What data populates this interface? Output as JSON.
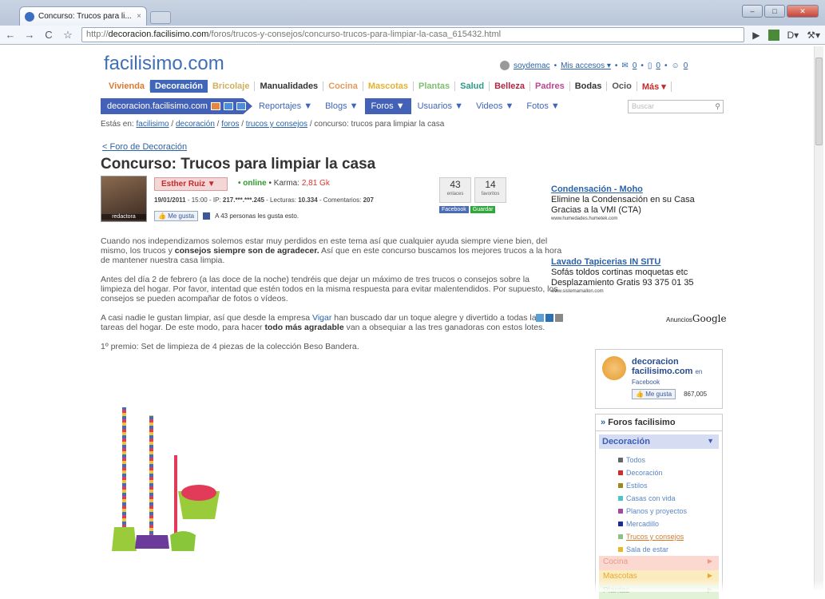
{
  "browser": {
    "tab_title": "Concurso: Trucos para li...",
    "tab_close": "×",
    "url_prefix": "http://",
    "url_domain": "decoracion.facilisimo.com",
    "url_path": "/foros/trucos-y-consejos/concurso-trucos-para-limpiar-la-casa_615432.html",
    "back": "←",
    "forward": "→",
    "reload": "C",
    "star": "☆",
    "page_menu": "D▾",
    "tools_menu": "⚒▾",
    "play": "▶"
  },
  "site": {
    "logo": "facilisimo.com",
    "user": {
      "username": "soydemac",
      "accesos": "Mis accesos ▾",
      "messages": "0",
      "notes": "0",
      "friends": "0"
    },
    "categories": [
      {
        "label": "Vivienda",
        "color": "#e0792c"
      },
      {
        "label": "Decoración",
        "color": "#ffffff"
      },
      {
        "label": "Bricolaje",
        "color": "#d0b060"
      },
      {
        "label": "Manualidades",
        "color": "#333333"
      },
      {
        "label": "Cocina",
        "color": "#e59a5a"
      },
      {
        "label": "Mascotas",
        "color": "#e6b12e"
      },
      {
        "label": "Plantas",
        "color": "#7cc06a"
      },
      {
        "label": "Salud",
        "color": "#2b9a8b"
      },
      {
        "label": "Belleza",
        "color": "#b02545"
      },
      {
        "label": "Padres",
        "color": "#c04590"
      },
      {
        "label": "Bodas",
        "color": "#333333"
      },
      {
        "label": "Ocio",
        "color": "#555555"
      },
      {
        "label": "Más ▾",
        "color": "#c42b2b"
      }
    ],
    "subnav_home": "decoracion.facilisimo.com",
    "subnav": [
      "Reportajes ▼",
      "Blogs ▼",
      "Foros ▼",
      "Usuarios ▼",
      "Videos ▼",
      "Fotos ▼"
    ],
    "search_placeholder": "Buscar",
    "search_icon": "⚲"
  },
  "breadcrumb": {
    "prefix": "Estás en:",
    "links": [
      "facilisimo",
      "decoración",
      "foros",
      "trucos y consejos"
    ],
    "current": "concurso: trucos para limpiar la casa"
  },
  "post": {
    "back_link": "< Foro de Decoración",
    "title": "Concurso: Trucos para limpiar la casa",
    "author": "Esther Ruiz ▼",
    "role": "redactora",
    "online": "• online",
    "karma_label": "• Karma:",
    "karma_value": "2,81 Gk",
    "date": "19/01/2011",
    "time": "- 15:00 - IP:",
    "ip": "217.***.***.245",
    "lecturas_label": "- Lecturas:",
    "lecturas": "10.334",
    "comentarios_label": "- Comentarios:",
    "comentarios": "207",
    "like_btn": "Me gusta",
    "like_text": "A 43 personas les gusta esto.",
    "enlaces": "43",
    "enlaces_label": "enlaces",
    "favoritos": "14",
    "favoritos_label": "favoritos",
    "facebook_btn": "Facebook",
    "guardar_btn": "Guardar",
    "p1a": "Cuando nos independizamos solemos estar muy perdidos en este tema así que cualquier ayuda siempre viene bien, del mismo, los trucos y ",
    "p1b": "consejos siempre son de agradecer.",
    "p1c": " Así que en este concurso buscamos los mejores trucos a la hora de mantener nuestra casa limpia.",
    "p2": "Antes del día 2 de febrero (a las doce de la noche) tendréis que dejar un máximo de tres trucos o consejos sobre la limpieza del hogar. Por favor, intentad que estén todos en la misma respuesta para evitar malentendidos. Por supuesto, los consejos se pueden acompañar de fotos o vídeos.",
    "p3a": "A casi nadie le gustan limpiar, así que desde la empresa ",
    "p3link": "Vigar",
    "p3b": " han buscado dar un toque alegre y divertido a todas las tareas del hogar. De este modo, para hacer ",
    "p3bold": "todo más agradable",
    "p3c": " van a obsequiar a las tres ganadoras con estos lotes.",
    "p4": "1º premio: Set de limpieza de 4 piezas de la colección Beso Bandera."
  },
  "ads": [
    {
      "title": "Condensación - Moho",
      "l1": "Elimine la Condensación en su Casa",
      "l2": "Gracias a la VMI (CTA)",
      "url": "www.humedades.humetek.com"
    },
    {
      "title": "Lavado Tapicerias IN SITU",
      "l1": "Sofás toldos cortinas moquetas etc",
      "l2": "Desplazamiento Gratis 93 375 01 35",
      "url": "www.sistemamallon.com"
    }
  ],
  "ads_by": {
    "label": "Anuncios",
    "brand": "Google"
  },
  "fb_box": {
    "name": "decoracion facilisimo.com",
    "en": "en",
    "fb": "Facebook",
    "like": "Me gusta",
    "count": "867,005"
  },
  "foros": {
    "header": "Foros facilisimo",
    "selected": "Decoración",
    "items": [
      {
        "label": "Todos",
        "color": "#666666"
      },
      {
        "label": "Decoración",
        "color": "#d42a2a"
      },
      {
        "label": "Estilos",
        "color": "#9a8a20"
      },
      {
        "label": "Casas con vida",
        "color": "#4ac4c8"
      },
      {
        "label": "Planos y proyectos",
        "color": "#a04aa0"
      },
      {
        "label": "Mercadillo",
        "color": "#1a2a9a"
      },
      {
        "label": "Trucos y consejos",
        "color": "#8ac08a"
      },
      {
        "label": "Sala de estar",
        "color": "#e6b82e"
      }
    ],
    "cats": [
      {
        "label": "Cocina",
        "bg": "#fbd9d0",
        "color": "#e59a8a"
      },
      {
        "label": "Mascotas",
        "bg": "#fbecc0",
        "color": "#e6a82e"
      },
      {
        "label": "Plantas",
        "bg": "#e2f2d6",
        "color": "#8ac07a"
      }
    ]
  }
}
